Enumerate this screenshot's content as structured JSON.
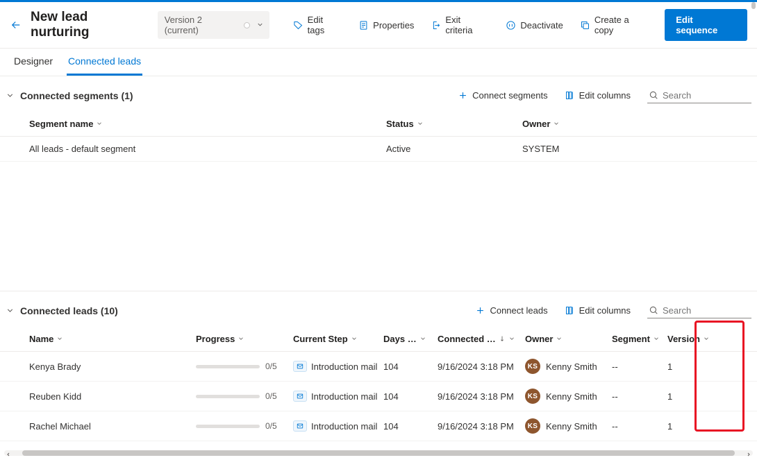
{
  "header": {
    "title": "New lead nurturing",
    "version_label": "Version 2 (current)"
  },
  "commands": {
    "edit_tags": "Edit tags",
    "properties": "Properties",
    "exit_criteria": "Exit criteria",
    "deactivate": "Deactivate",
    "create_copy": "Create a copy",
    "edit_sequence": "Edit sequence"
  },
  "tabs": {
    "designer": "Designer",
    "connected_leads": "Connected leads"
  },
  "segments_section": {
    "title": "Connected segments (1)",
    "connect_action": "Connect segments",
    "edit_columns": "Edit columns",
    "search_placeholder": "Search",
    "columns": {
      "name": "Segment name",
      "status": "Status",
      "owner": "Owner"
    },
    "rows": [
      {
        "name": "All leads - default segment",
        "status": "Active",
        "owner": "SYSTEM"
      }
    ]
  },
  "leads_section": {
    "title": "Connected leads (10)",
    "connect_action": "Connect leads",
    "edit_columns": "Edit columns",
    "search_placeholder": "Search",
    "columns": {
      "name": "Name",
      "progress": "Progress",
      "current_step": "Current Step",
      "days": "Days …",
      "connected": "Connected …",
      "owner": "Owner",
      "segment": "Segment",
      "version": "Version"
    },
    "rows": [
      {
        "name": "Kenya Brady",
        "progress": "0/5",
        "step": "Introduction mail",
        "days": "104",
        "connected": "9/16/2024 3:18 PM",
        "owner_initials": "KS",
        "owner": "Kenny Smith",
        "segment": "--",
        "version": "1"
      },
      {
        "name": "Reuben Kidd",
        "progress": "0/5",
        "step": "Introduction mail",
        "days": "104",
        "connected": "9/16/2024 3:18 PM",
        "owner_initials": "KS",
        "owner": "Kenny Smith",
        "segment": "--",
        "version": "1"
      },
      {
        "name": "Rachel Michael",
        "progress": "0/5",
        "step": "Introduction mail",
        "days": "104",
        "connected": "9/16/2024 3:18 PM",
        "owner_initials": "KS",
        "owner": "Kenny Smith",
        "segment": "--",
        "version": "1"
      }
    ]
  }
}
